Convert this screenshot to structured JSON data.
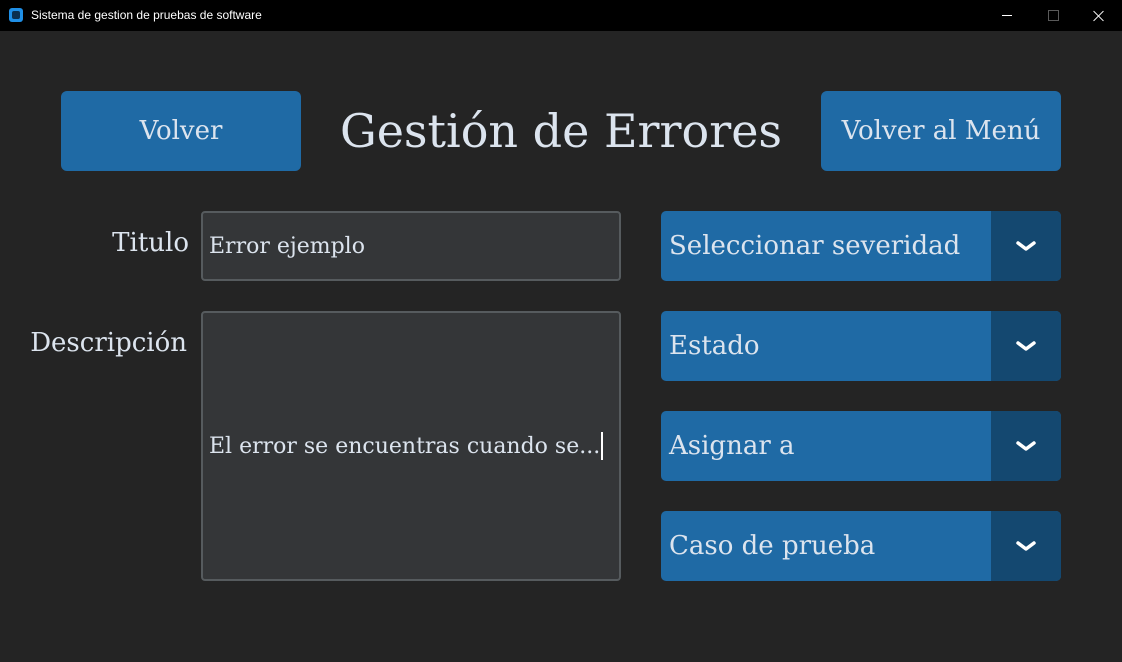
{
  "window": {
    "title": "Sistema de gestion de pruebas de software"
  },
  "header": {
    "back_label": "Volver",
    "title": "Gestión de Errores",
    "menu_label": "Volver al Menú"
  },
  "form": {
    "title_label": "Titulo",
    "title_value": "Error ejemplo",
    "description_label": "Descripción",
    "description_value": "El error se encuentras cuando se..."
  },
  "dropdowns": [
    {
      "label": "Seleccionar severidad",
      "icon": "chevron-down-icon"
    },
    {
      "label": "Estado",
      "icon": "chevron-down-icon"
    },
    {
      "label": "Asignar a",
      "icon": "chevron-down-icon"
    },
    {
      "label": "Caso de prueba",
      "icon": "chevron-down-icon"
    }
  ],
  "colors": {
    "background": "#242424",
    "button": "#1f6aa5",
    "dropdown_arrow_bg": "#144870",
    "field_bg": "#343638",
    "field_border": "#565b5e",
    "text": "#dce4ee"
  }
}
